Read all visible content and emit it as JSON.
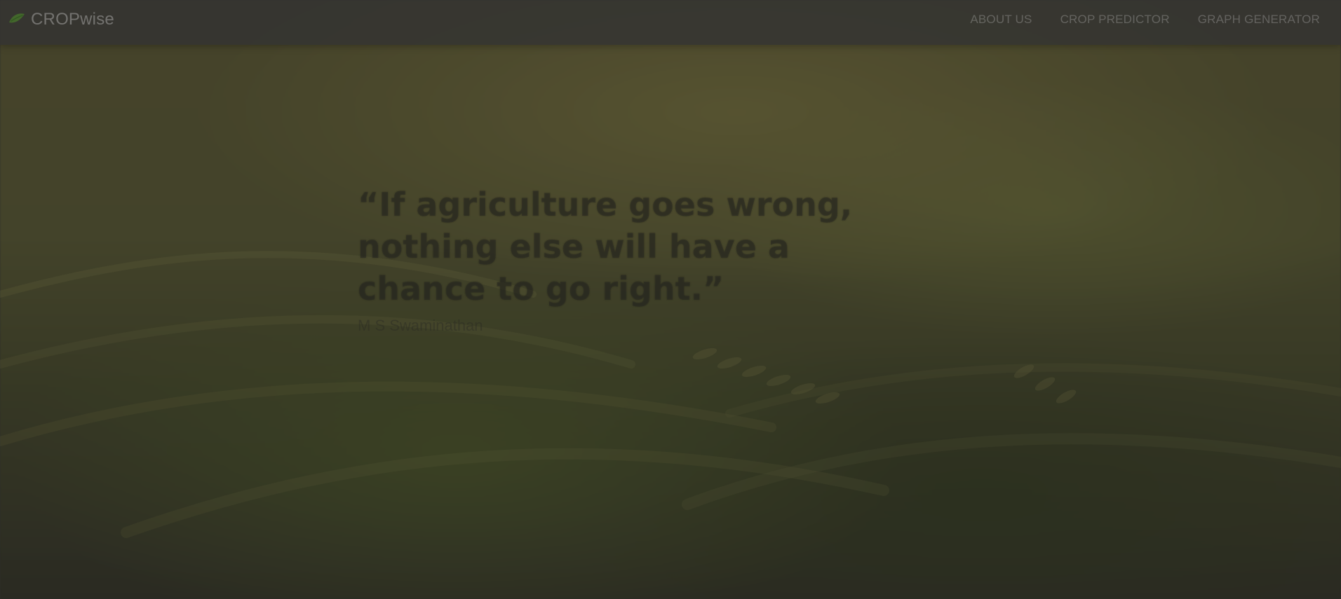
{
  "brand": {
    "name": "CROPwise",
    "icon": "leaf-icon",
    "accent": "#4f8f2a"
  },
  "nav": {
    "items": [
      {
        "label": "ABOUT US",
        "name": "nav-about-us"
      },
      {
        "label": "CROP PREDICTOR",
        "name": "nav-crop-predictor"
      },
      {
        "label": "GRAPH GENERATOR",
        "name": "nav-graph-generator"
      }
    ]
  },
  "hero": {
    "quote": "“If agriculture goes wrong, nothing else will have a chance to go right.”",
    "author": "M S Swaminathan"
  }
}
